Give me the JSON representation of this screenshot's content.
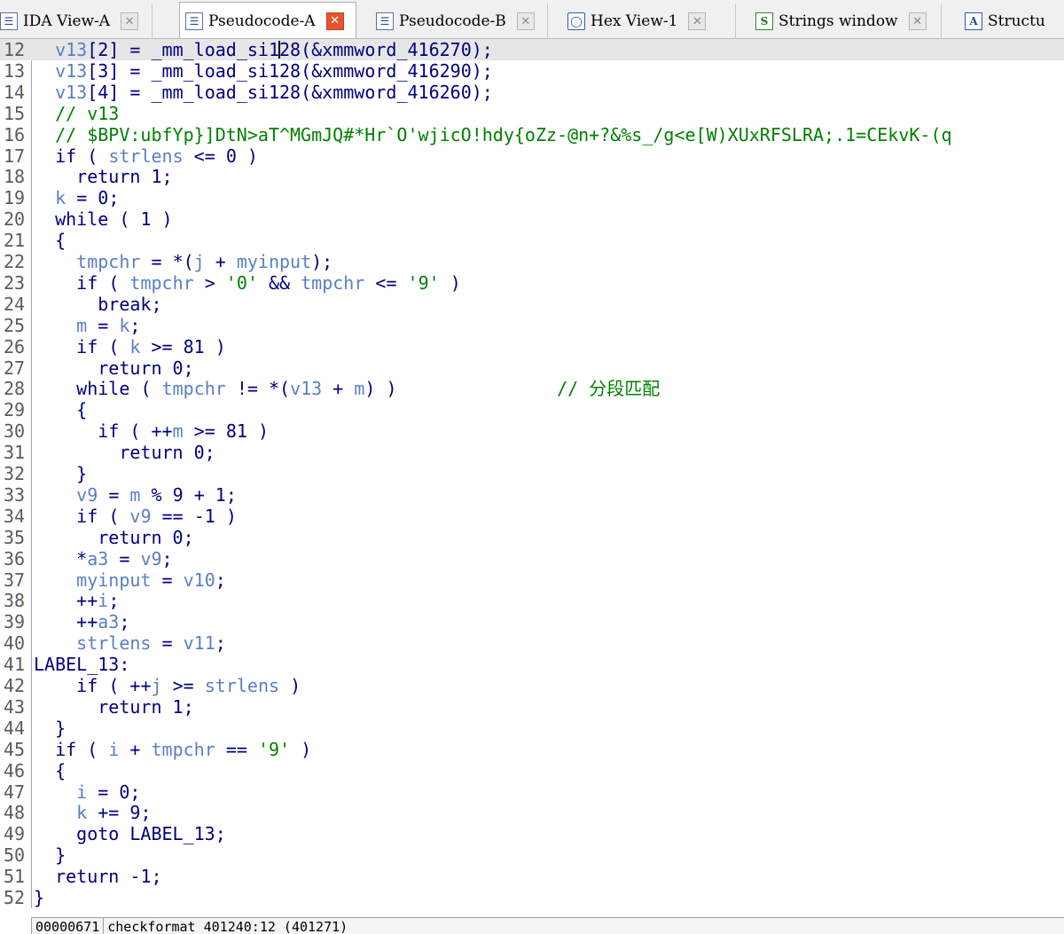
{
  "tabs": [
    {
      "label": "IDA View-A",
      "icon": "doc-icon",
      "active": false
    },
    {
      "label": "Pseudocode-A",
      "icon": "doc-icon",
      "active": true
    },
    {
      "label": "Pseudocode-B",
      "icon": "doc-icon",
      "active": false
    },
    {
      "label": "Hex View-1",
      "icon": "hex-icon",
      "active": false
    },
    {
      "label": "Strings window",
      "icon": "strings-icon",
      "active": false
    },
    {
      "label": "Structu",
      "icon": "struct-icon",
      "active": false
    }
  ],
  "code_lines": [
    {
      "n": "12",
      "text": "  v13[2] = _mm_load_si128(&xmmword_416270);"
    },
    {
      "n": "13",
      "text": "  v13[3] = _mm_load_si128(&xmmword_416290);"
    },
    {
      "n": "14",
      "text": "  v13[4] = _mm_load_si128(&xmmword_416260);"
    },
    {
      "n": "15",
      "text": "  // v13"
    },
    {
      "n": "16",
      "text": "  // $BPV:ubfYp}]DtN>aT^MGmJQ#*Hr`O'wjicO!hdy{oZz-@n+?&%s_/g<e[W)XUxRFSLRA;.1=CEkvK-(q"
    },
    {
      "n": "17",
      "text": "  if ( strlens <= 0 )"
    },
    {
      "n": "18",
      "text": "    return 1;"
    },
    {
      "n": "19",
      "text": "  k = 0;"
    },
    {
      "n": "20",
      "text": "  while ( 1 )"
    },
    {
      "n": "21",
      "text": "  {"
    },
    {
      "n": "22",
      "text": "    tmpchr = *(j + myinput);"
    },
    {
      "n": "23",
      "text": "    if ( tmpchr > '0' && tmpchr <= '9' )"
    },
    {
      "n": "24",
      "text": "      break;"
    },
    {
      "n": "25",
      "text": "    m = k;"
    },
    {
      "n": "26",
      "text": "    if ( k >= 81 )"
    },
    {
      "n": "27",
      "text": "      return 0;"
    },
    {
      "n": "28",
      "text": "    while ( tmpchr != *(v13 + m) )               // 分段匹配"
    },
    {
      "n": "29",
      "text": "    {"
    },
    {
      "n": "30",
      "text": "      if ( ++m >= 81 )"
    },
    {
      "n": "31",
      "text": "        return 0;"
    },
    {
      "n": "32",
      "text": "    }"
    },
    {
      "n": "33",
      "text": "    v9 = m % 9 + 1;"
    },
    {
      "n": "34",
      "text": "    if ( v9 == -1 )"
    },
    {
      "n": "35",
      "text": "      return 0;"
    },
    {
      "n": "36",
      "text": "    *a3 = v9;"
    },
    {
      "n": "37",
      "text": "    myinput = v10;"
    },
    {
      "n": "38",
      "text": "    ++i;"
    },
    {
      "n": "39",
      "text": "    ++a3;"
    },
    {
      "n": "40",
      "text": "    strlens = v11;"
    },
    {
      "n": "41",
      "text": "LABEL_13:"
    },
    {
      "n": "42",
      "text": "    if ( ++j >= strlens )"
    },
    {
      "n": "43",
      "text": "      return 1;"
    },
    {
      "n": "44",
      "text": "  }"
    },
    {
      "n": "45",
      "text": "  if ( i + tmpchr == '9' )"
    },
    {
      "n": "46",
      "text": "  {"
    },
    {
      "n": "47",
      "text": "    i = 0;"
    },
    {
      "n": "48",
      "text": "    k += 9;"
    },
    {
      "n": "49",
      "text": "    goto LABEL_13;"
    },
    {
      "n": "50",
      "text": "  }"
    },
    {
      "n": "51",
      "text": "  return -1;"
    },
    {
      "n": "52",
      "text": "}"
    }
  ],
  "status_bar": {
    "offset": "00000671",
    "location": "checkformat_401240:12 (401271)"
  }
}
